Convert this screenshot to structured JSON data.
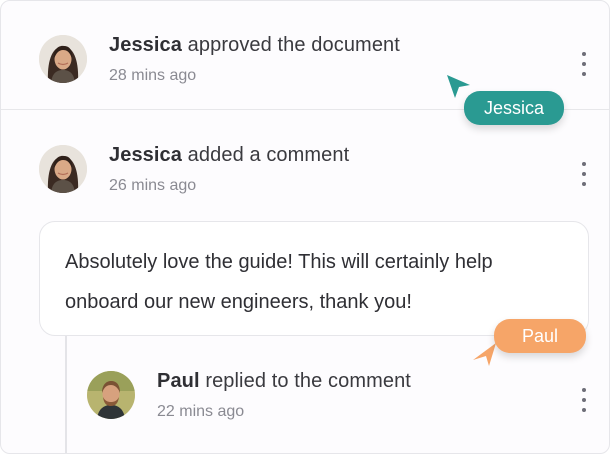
{
  "activity": [
    {
      "actor": "Jessica",
      "action": "approved the document",
      "time": "28 mins ago"
    },
    {
      "actor": "Jessica",
      "action": "added a comment",
      "time": "26 mins ago",
      "comment": "Absolutely love the guide! This will certainly help onboard our new engineers, thank you!"
    },
    {
      "actor": "Paul",
      "action": "replied to the comment",
      "time": "22 mins ago"
    }
  ],
  "cursors": [
    {
      "name": "Jessica",
      "color": "#2a9a92"
    },
    {
      "name": "Paul",
      "color": "#f6a568"
    }
  ],
  "icons": {
    "avatar_jessica": "avatar-jessica",
    "avatar_paul": "avatar-paul",
    "menu": "more-vertical-icon",
    "cursor": "cursor-arrow-icon"
  }
}
